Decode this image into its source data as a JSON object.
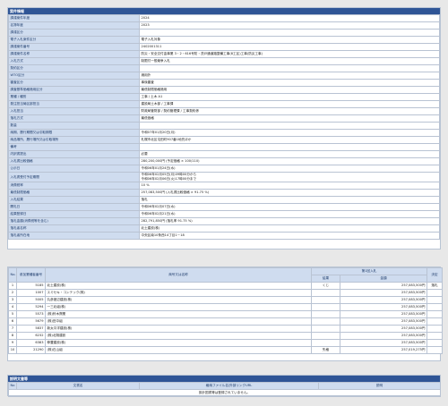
{
  "case_section": {
    "title": "案件情報",
    "rows": [
      {
        "label": "調達案件年度",
        "value": "2024"
      },
      {
        "label": "名簿年度",
        "value": "2023"
      },
      {
        "label": "調達区分",
        "value": ""
      },
      {
        "label": "電子入札案件区分",
        "value": "電子入札対象"
      },
      {
        "label": "調達案件番号",
        "value": "2402001311"
      },
      {
        "label": "調達案件名称",
        "value": "防災・安全交付金事業 3・2・616号防・茨戸通道路整備工事(8工区)工事(防災工事)"
      },
      {
        "label": "入札方式",
        "value": "制限付一般競争入札"
      },
      {
        "label": "契約区分",
        "value": ""
      },
      {
        "label": "WTO区分",
        "value": "適用外"
      },
      {
        "label": "審査区分",
        "value": "事後審査"
      },
      {
        "label": "調査基準価格適用区分",
        "value": "最低制限価格適用"
      },
      {
        "label": "業種 / 種別",
        "value": "工事 / 土木 A1"
      },
      {
        "label": "発注担当局区部担当",
        "value": "建設局土木部 / 工事課"
      },
      {
        "label": "入札担当",
        "value": "財政局管財部 / 契約管理課 / 工事契約係"
      },
      {
        "label": "落札方式",
        "value": "最低価格"
      },
      {
        "label": "数量",
        "value": ""
      },
      {
        "label": "納期、履行期間又は引取期限",
        "value": "令和07年01月20日(月)"
      },
      {
        "label": "納品場所、履行場所又は引取場所",
        "value": "札幌市北区屯田町907番1地先ほか"
      },
      {
        "label": "備考",
        "value": ""
      },
      {
        "label": "内訳書提出",
        "value": "必要"
      },
      {
        "label": "入札書比較価格",
        "value": "280,200,000円 (予定価格 × 100/110)"
      },
      {
        "label": "公示日",
        "value": "令和06年01月24日(水)"
      },
      {
        "label": "入札書受付予定期間",
        "value": "令和06年02月05日(月)09時00分から",
        "value2": "令和06年02月06日(火)17時00分まで"
      },
      {
        "label": "消費税率",
        "value": "10 %"
      },
      {
        "label": "最低制限価格",
        "value": "257,083,500円 (入札書比較価格 × 91.75 %)"
      },
      {
        "label": "入札結果",
        "value": "落札"
      },
      {
        "label": "開札日",
        "value": "令和06年02月07日(水)"
      },
      {
        "label": "結果登録日",
        "value": "令和06年02月21日(水)"
      },
      {
        "label": "落札金額(消費税等を含む)",
        "value": "282,791,850円 (落札率 91.75 %)"
      },
      {
        "label": "落札者名称",
        "value": "北土建設(株)"
      },
      {
        "label": "落札者所在地",
        "value": "中央区南10条西14丁目1－18"
      }
    ]
  },
  "bid_table": {
    "headers": {
      "no": "No.",
      "bidder_no": "参加業種者番号",
      "name": "商号又は名称",
      "round": "第1回入札",
      "result": "結果",
      "amount": "金額",
      "decision": "決定"
    },
    "rows": [
      {
        "no": "1",
        "bidder_no": "5185",
        "name": "北土建設(株)",
        "result": "くじ",
        "amount": "257,083,500円",
        "decision": "落札"
      },
      {
        "no": "2",
        "bidder_no": "1007",
        "name": "スミセキ・コンテック(株)",
        "result": "",
        "amount": "257,083,500円",
        "decision": ""
      },
      {
        "no": "3",
        "bidder_no": "5005",
        "name": "丸彦渡辺建設(株)",
        "result": "",
        "amount": "257,083,500円",
        "decision": ""
      },
      {
        "no": "4",
        "bidder_no": "5294",
        "name": "一三北組(株)",
        "result": "",
        "amount": "257,083,500円",
        "decision": ""
      },
      {
        "no": "5",
        "bidder_no": "5573",
        "name": "(株)鈴木興業",
        "result": "",
        "amount": "257,083,500円",
        "decision": ""
      },
      {
        "no": "6",
        "bidder_no": "5679",
        "name": "(株)田中組",
        "result": "",
        "amount": "257,083,500円",
        "decision": ""
      },
      {
        "no": "7",
        "bidder_no": "5837",
        "name": "新太平洋建設(株)",
        "result": "",
        "amount": "257,083,500円",
        "decision": ""
      },
      {
        "no": "8",
        "bidder_no": "6232",
        "name": "(株)北翔建設",
        "result": "",
        "amount": "257,083,500円",
        "decision": ""
      },
      {
        "no": "9",
        "bidder_no": "6383",
        "name": "伸豊建設(株)",
        "result": "",
        "amount": "257,083,500円",
        "decision": ""
      },
      {
        "no": "10",
        "bidder_no": "21290",
        "name": "(株)石山組",
        "result": "失格",
        "amount": "257,019,275円",
        "decision": ""
      }
    ]
  },
  "docs_section": {
    "title": "説明文書等",
    "headers": {
      "no": "No",
      "doc_name": "文書名",
      "file": "格納ファイル名/外部リンクURL",
      "desc": "説明"
    },
    "empty_message": "設計図書等は登録されていません。"
  }
}
